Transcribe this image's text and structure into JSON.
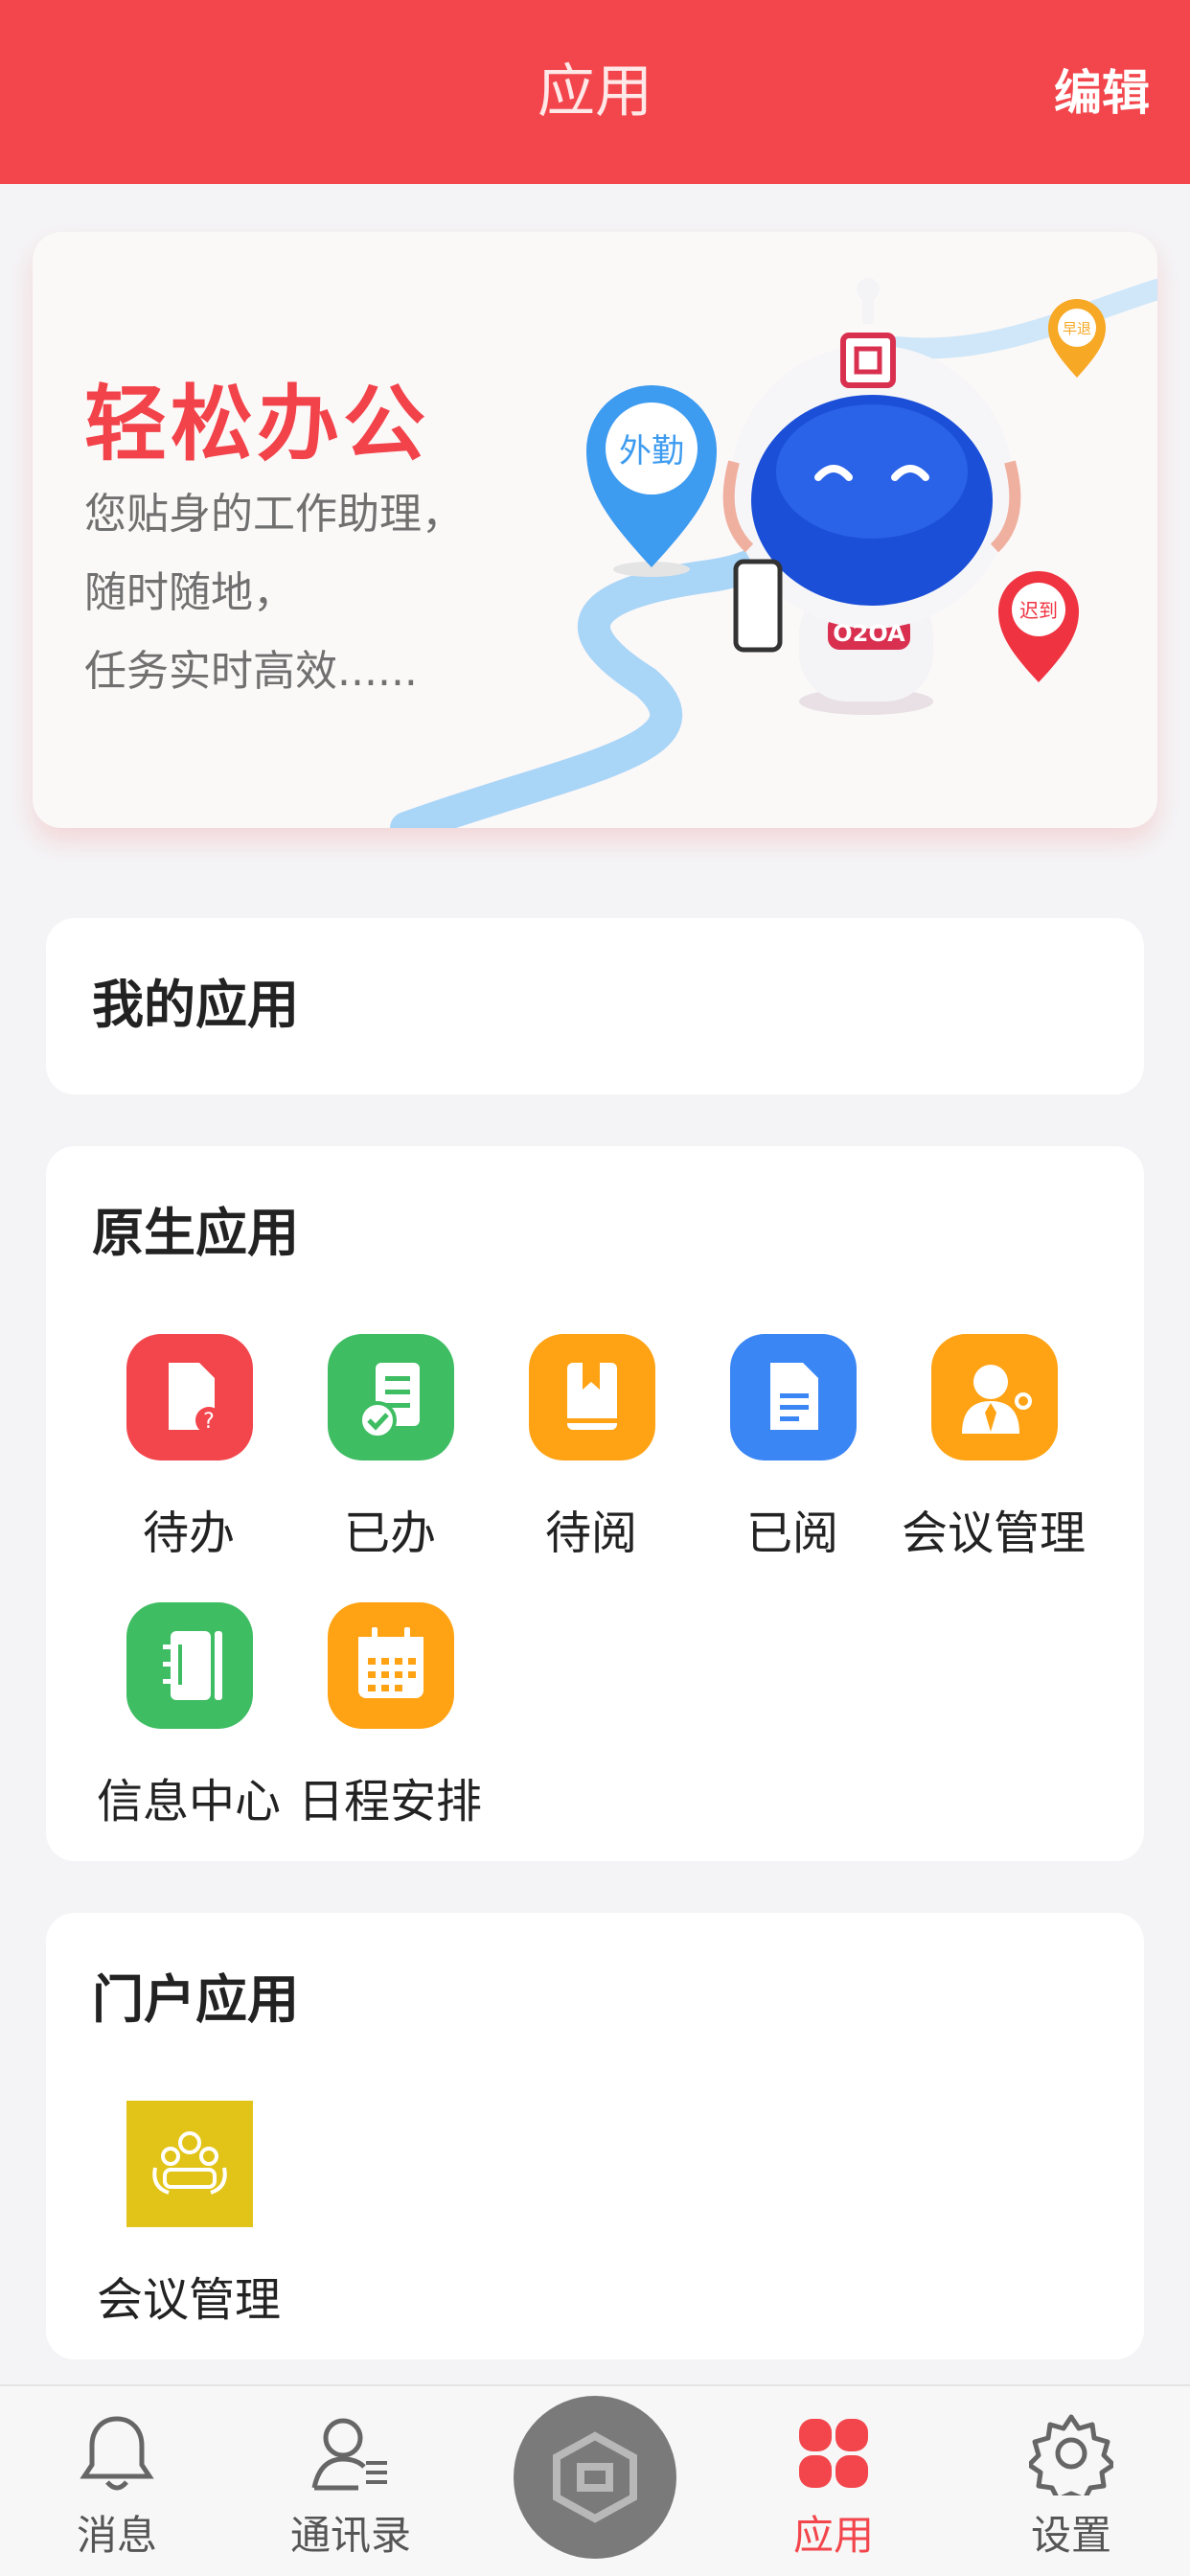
{
  "header": {
    "title": "应用",
    "edit_label": "编辑"
  },
  "banner": {
    "slogan": "轻松办公",
    "lines": [
      "您贴身的工作助理，",
      "随时随地，",
      "任务实时高效......"
    ],
    "pin_outwork": "外勤",
    "pin_early": "早退",
    "pin_late": "迟到",
    "robot_badge": "O2OA"
  },
  "my_apps": {
    "title": "我的应用"
  },
  "native_apps": {
    "title": "原生应用",
    "items": [
      {
        "label": "待办",
        "icon": "todo-icon",
        "color": "#f2464c"
      },
      {
        "label": "已办",
        "icon": "done-icon",
        "color": "#3fbd63"
      },
      {
        "label": "待阅",
        "icon": "to-read-icon",
        "color": "#ffa314"
      },
      {
        "label": "已阅",
        "icon": "read-icon",
        "color": "#3a86f5"
      },
      {
        "label": "会议管理",
        "icon": "meeting-icon",
        "color": "#ffa314"
      },
      {
        "label": "信息中心",
        "icon": "info-center-icon",
        "color": "#3fbd63"
      },
      {
        "label": "日程安排",
        "icon": "calendar-icon",
        "color": "#ffa314"
      }
    ]
  },
  "portal_apps": {
    "title": "门户应用",
    "items": [
      {
        "label": "会议管理",
        "icon": "portal-meeting-icon",
        "color": "#e2c418"
      }
    ]
  },
  "tabbar": {
    "items": [
      {
        "label": "消息",
        "icon": "bell-icon"
      },
      {
        "label": "通讯录",
        "icon": "contacts-icon"
      },
      {
        "label": "",
        "icon": "o2-home-icon"
      },
      {
        "label": "应用",
        "icon": "apps-icon",
        "active": true
      },
      {
        "label": "设置",
        "icon": "gear-icon"
      }
    ],
    "active_color": "#f2464c"
  }
}
